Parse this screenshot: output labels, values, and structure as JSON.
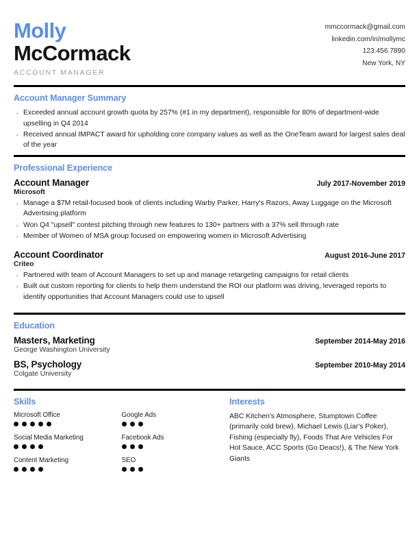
{
  "theme": {
    "accent": "#5b8def",
    "text": "#1a1a1a",
    "muted": "#9a9a9a",
    "rule": "#000000"
  },
  "header": {
    "first_name": "Molly",
    "last_name": "McCormack",
    "job_title": "ACCOUNT MANAGER",
    "contact": {
      "email": "mmccormack@gmail.com",
      "linkedin": "linkedin.com/in/mollymc",
      "phone": "123.456.7890",
      "location": "New York, NY"
    }
  },
  "summary": {
    "title": "Account Manager Summary",
    "bullets": [
      "Exceeded annual account growth quota by 257% (#1 in my department), responsible for 80% of department-wide upselling in Q4 2014",
      "Received annual IMPACT award for upholding core company values as well as the OneTeam award for largest sales deal of the year"
    ]
  },
  "experience": {
    "title": "Professional Experience",
    "jobs": [
      {
        "role": "Account Manager",
        "date": "July 2017-November 2019",
        "company": "Microsoft",
        "bullets": [
          "Manage a $7M retail-focused book of clients including Warby Parker, Harry's Razors, Away Luggage on the Microsoft Advertising platform",
          "Won Q4 \"upsell\" contest pitching through new features to 130+ partners with a 37% sell through rate",
          "Member of Women of MSA group focused on empowering women in Microsoft Advertising"
        ]
      },
      {
        "role": "Account Coordinator",
        "date": "August 2016-June 2017",
        "company": "Criteo",
        "bullets": [
          "Partnered with team of Account Managers to set up and manage retargeting campaigns for retail clients",
          "Built out custom reporting for clients to help them understand the ROI our platform was driving, leveraged reports to identify opportunities that Account Managers could use to upsell"
        ]
      }
    ]
  },
  "education": {
    "title": "Education",
    "entries": [
      {
        "degree": "Masters, Marketing",
        "date": "September 2014-May 2016",
        "school": "George Washington University"
      },
      {
        "degree": "BS, Psychology",
        "date": "September 2010-May 2014",
        "school": "Colgate University"
      }
    ]
  },
  "skills": {
    "title": "Skills",
    "items": [
      {
        "name": "Microsoft Office",
        "level": 5
      },
      {
        "name": "Google Ads",
        "level": 3
      },
      {
        "name": "Social Media Marketing",
        "level": 4
      },
      {
        "name": "Facebook Ads",
        "level": 3
      },
      {
        "name": "Content Marketing",
        "level": 4
      },
      {
        "name": "SEO",
        "level": 3
      }
    ]
  },
  "interests": {
    "title": "Interests",
    "text": "ABC Kitchen's Atmosphere, Stumptown Coffee (primarily cold brew), Michael Lewis (Liar's Poker), Fishing (especially fly), Foods That Are Vehicles For Hot Sauce, ACC Sports (Go Deacs!), & The New York Giants"
  }
}
